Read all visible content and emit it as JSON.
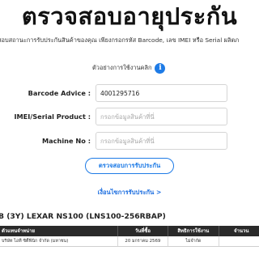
{
  "header": {
    "title": "ตรวจสอบอายุประกัน",
    "subtitle": "สอบสถานะการรับประกันสินค้าของคุณ เพียงกรอกรหัส Barcode, เลข IMEI หรือ Serial ผลิตภ",
    "example_label": "ตัวอย่างการใช้งานคลิก",
    "info_icon": "i"
  },
  "form": {
    "fields": [
      {
        "label": "Barcode Advice :",
        "value": "4001295716",
        "placeholder": ""
      },
      {
        "label": "IMEI/Serial Product :",
        "value": "",
        "placeholder": "กรอกข้อมูลสินค้าที่นี่"
      },
      {
        "label": "Machine No :",
        "value": "",
        "placeholder": "กรอกข้อมูลสินค้าที่นี่"
      }
    ],
    "check_button": "ตรวจสอบการรับประกัน",
    "terms_link": "เงื่อนไขการรับประกัน >"
  },
  "result": {
    "product_title": "B (3Y) LEXAR NS100 (LNS100-256RBAP)",
    "table": {
      "headers": [
        "ตัวแทนจำหน่าย",
        "วันที่ซื้อ",
        "สิทธิการใช้งาน",
        "จำนวน"
      ],
      "rows": [
        [
          "บริษัท ไอที ซิตี้ฟินิก จำกัด (มหาชน)",
          "20 มกราคม 2569",
          "ไม่จำกัด",
          ""
        ]
      ]
    }
  },
  "colors": {
    "accent": "#1e7be6",
    "header_bg": "#2a2a2a"
  }
}
